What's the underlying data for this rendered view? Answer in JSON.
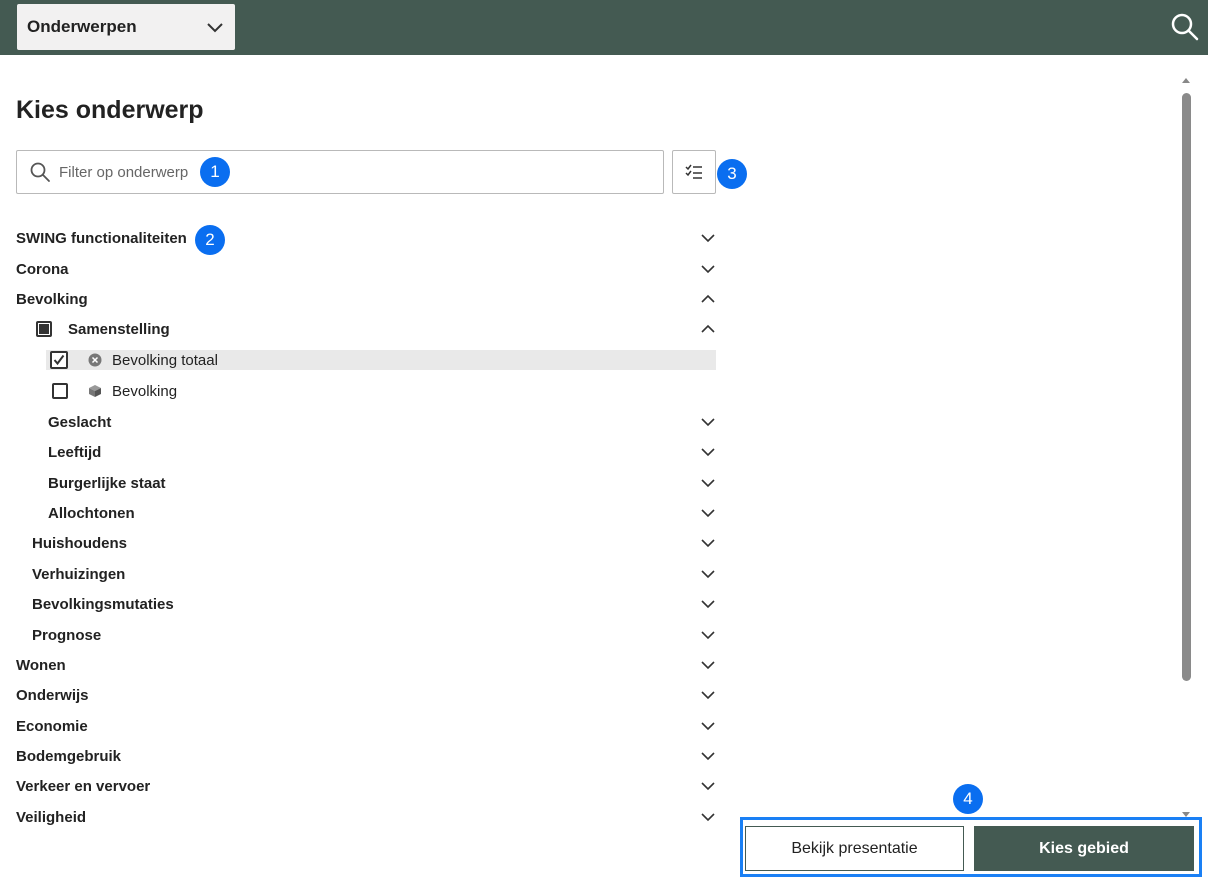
{
  "topbar": {
    "dropdown_label": "Onderwerpen",
    "search_icon": "search-icon",
    "background": "#445a52"
  },
  "page": {
    "title": "Kies onderwerp"
  },
  "filter": {
    "placeholder": "Filter op onderwerp"
  },
  "badges": [
    "1",
    "2",
    "3",
    "4"
  ],
  "tree": {
    "swing": "SWING functionaliteiten",
    "corona": "Corona",
    "bevolking": "Bevolking",
    "samenstelling": "Samenstelling",
    "bevolking_totaal": "Bevolking totaal",
    "bevolking_leaf": "Bevolking",
    "geslacht": "Geslacht",
    "leeftijd": "Leeftijd",
    "burgerlijke_staat": "Burgerlijke staat",
    "allochtonen": "Allochtonen",
    "huishoudens": "Huishoudens",
    "verhuizingen": "Verhuizingen",
    "bevolkingsmutaties": "Bevolkingsmutaties",
    "prognose": "Prognose",
    "wonen": "Wonen",
    "onderwijs": "Onderwijs",
    "economie": "Economie",
    "bodemgebruik": "Bodemgebruik",
    "verkeer": "Verkeer en vervoer",
    "veiligheid": "Veiligheid"
  },
  "footer": {
    "secondary_label": "Bekijk presentatie",
    "primary_label": "Kies gebied"
  },
  "colors": {
    "accent": "#445a52",
    "badge": "#0a6ef0",
    "highlight": "#e9e9e9"
  }
}
